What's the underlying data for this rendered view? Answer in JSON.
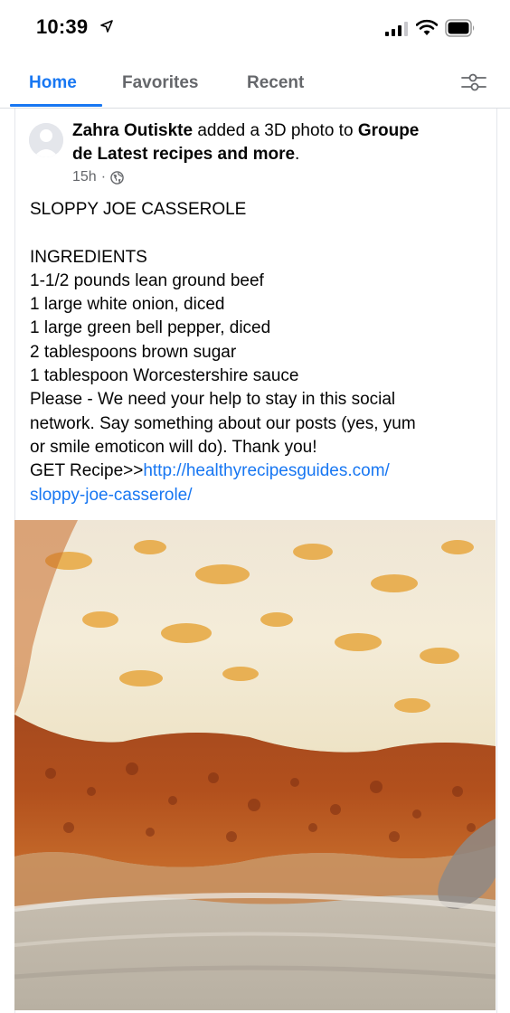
{
  "status_bar": {
    "time": "10:39",
    "icons": [
      "location-arrow-icon",
      "signal-icon",
      "wifi-icon",
      "battery-icon"
    ]
  },
  "tabs": [
    {
      "label": "Home",
      "active": true
    },
    {
      "label": "Favorites",
      "active": false
    },
    {
      "label": "Recent",
      "active": false
    }
  ],
  "filter_icon": "filter-sliders-icon",
  "post": {
    "author": "Zahra Outiskte",
    "action": " added a 3D photo to ",
    "group_line1": "Groupe",
    "group_line2": "de Latest recipes and more",
    "period": ".",
    "time_ago": "15h",
    "separator": "·",
    "privacy_icon": "globe-icon",
    "title": "SLOPPY JOE CASSEROLE",
    "ingredients_heading": "INGREDIENTS",
    "ingredients": [
      "1-1/2 pounds lean ground beef",
      "1 large white onion, diced",
      "1 large green bell pepper, diced",
      "2 tablespoons brown sugar",
      "1 tablespoon Worcestershire sauce"
    ],
    "message_lines": [
      "Please - We need your help to stay in this social",
      "network. Say something about our posts (yes, yum",
      "or smile emoticon will do). Thank you!"
    ],
    "get_recipe_label": "GET Recipe>>",
    "link_part1": "http://healthyrecipesguides.com/",
    "link_part2": "sloppy-joe-casserole/"
  },
  "colors": {
    "accent": "#1877f2",
    "secondary_text": "#65676b",
    "primary_text": "#050505"
  }
}
